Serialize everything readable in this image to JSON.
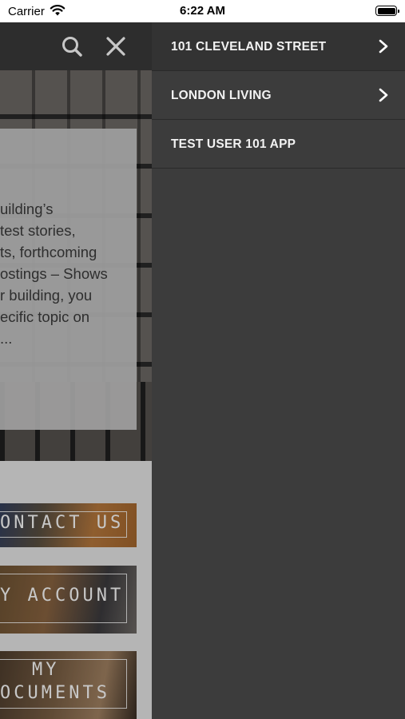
{
  "status_bar": {
    "carrier": "Carrier",
    "time": "6:22 AM",
    "icons": [
      "wifi-icon",
      "battery-icon"
    ]
  },
  "header": {
    "icons": [
      "search-icon",
      "close-icon"
    ],
    "background": "#3a3a3a"
  },
  "hero": {
    "text_lines": [
      "uilding’s",
      "test stories,",
      "ts, forthcoming",
      "ostings – Shows",
      "r building, you",
      "ecific topic on",
      "..."
    ]
  },
  "tiles": [
    {
      "label_lines": [
        "ONTACT US"
      ]
    },
    {
      "label_lines": [
        "Y ACCOUNT"
      ]
    },
    {
      "label_lines": [
        "MY",
        "OCUMENTS"
      ]
    }
  ],
  "menu": {
    "background": "#3c3c3c",
    "items": [
      {
        "label": "101 CLEVELAND STREET",
        "has_chevron": true,
        "icon": "chevron-right-icon"
      },
      {
        "label": "LONDON LIVING",
        "has_chevron": true,
        "icon": "chevron-right-icon"
      },
      {
        "label": "TEST USER 101 APP",
        "has_chevron": false
      }
    ]
  }
}
